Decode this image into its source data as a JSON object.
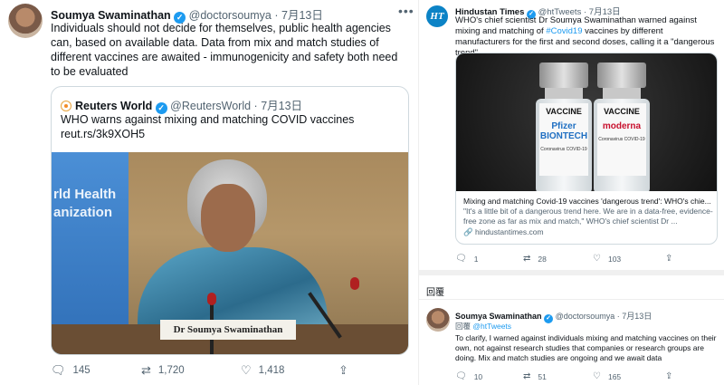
{
  "main_tweet": {
    "author_name": "Soumya Swaminathan",
    "handle": "@doctorsoumya",
    "separator": "·",
    "date": "7月13日",
    "more_icon": "more-horizontal-icon",
    "text": "Individuals should not decide for themselves, public health agencies can, based on available data. Data from mix and match studies of different vaccines are awaited - immunogenicity and safety both need to be evaluated",
    "quoted": {
      "author_name": "Reuters World",
      "handle": "@ReutersWorld",
      "date": "7月13日",
      "text": "WHO warns against mixing and matching COVID vaccines",
      "link": "reut.rs/3k9XOH5",
      "image": {
        "nameplate": "Dr Soumya Swaminathan",
        "banner_lines": [
          "rld Health",
          "anization"
        ]
      }
    },
    "actions": {
      "replies": "145",
      "retweets": "1,720",
      "likes": "1,418"
    }
  },
  "right_tweet": {
    "author_name": "Hindustan Times",
    "logo_text": "HT",
    "handle": "@htTweets",
    "separator": "·",
    "date": "7月13日",
    "text_before": "WHO's chief scientist Dr Soumya Swaminathan warned against mixing and matching of ",
    "hashtag": "#Covid19",
    "text_after": " vaccines by different manufacturers for the first and second doses, calling it a \"dangerous trend\"",
    "card": {
      "title": "Mixing and matching Covid-19 vaccines 'dangerous trend': WHO's chie...",
      "description": "\"It's a little bit of a dangerous trend here. We are in a data-free, evidence-free zone as far as mix and match,\" WHO's chief scientist Dr ...",
      "domain": "hindustantimes.com",
      "vials": [
        {
          "label": "VACCINE",
          "brand": "Pfizer BIONTECH",
          "sub": "Coronavirus COVID-19",
          "brand_color": "#1f6fc2"
        },
        {
          "label": "VACCINE",
          "brand": "moderna",
          "sub": "Coronavirus COVID-19",
          "brand_color": "#c8102e"
        }
      ]
    },
    "actions": {
      "replies": "1",
      "retweets": "28",
      "likes": "103"
    }
  },
  "reply_section": {
    "label": "回覆",
    "author_name": "Soumya Swaminathan",
    "handle": "@doctorsoumya",
    "separator": "·",
    "date": "7月13日",
    "reply_prefix": "回覆",
    "reply_to": "@htTweets",
    "text": "To clarify, I warned against individuals mixing and matching vaccines on their own, not against research studies that companies or research groups are doing. Mix and match studies are ongoing and we await data",
    "actions": {
      "replies": "10",
      "retweets": "51",
      "likes": "165"
    }
  },
  "colors": {
    "accent": "#1d9bf0",
    "text": "#0f1419",
    "secondary": "#536471",
    "border": "#cfd9de"
  }
}
